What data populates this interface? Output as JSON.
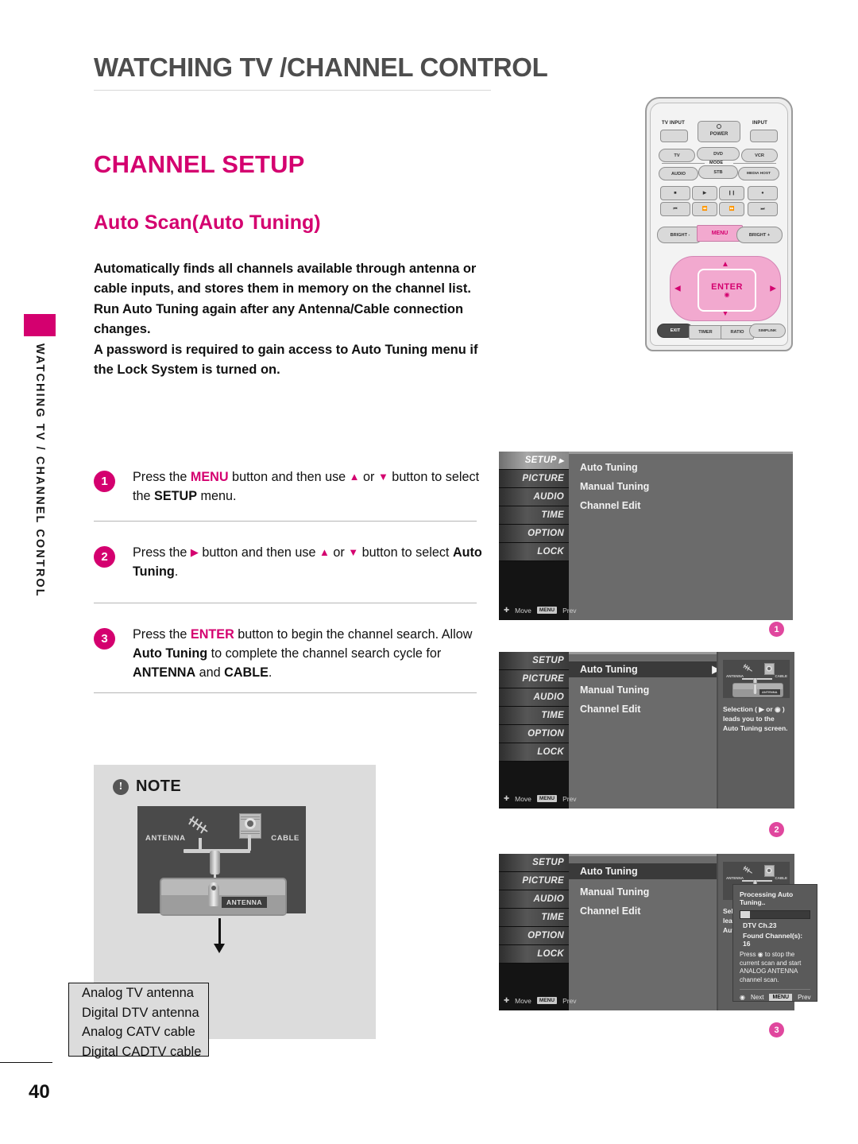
{
  "page": {
    "number": "40",
    "doc_title": "WATCHING TV /CHANNEL CONTROL",
    "side_tab_label": "WATCHING TV / CHANNEL CONTROL"
  },
  "headings": {
    "h1": "CHANNEL SETUP",
    "h2": "Auto Scan(Auto Tuning)"
  },
  "intro": {
    "p1": "Automatically finds all channels available through antenna or cable inputs, and stores them in memory on the channel list.",
    "p2": "Run Auto Tuning again after any Antenna/Cable connection changes.",
    "p3": "A password is required to gain access to Auto Tuning menu if the Lock System is turned on."
  },
  "steps": [
    {
      "num": "1",
      "parts": [
        {
          "t": "Press the ",
          "style": "normal"
        },
        {
          "t": "MENU",
          "style": "magenta"
        },
        {
          "t": " button and then use ",
          "style": "normal"
        },
        {
          "t": "▲",
          "style": "arrow"
        },
        {
          "t": " or ",
          "style": "normal"
        },
        {
          "t": "▼",
          "style": "arrow"
        },
        {
          "t": " button to select the ",
          "style": "normal"
        },
        {
          "t": "SETUP",
          "style": "bold"
        },
        {
          "t": " menu.",
          "style": "normal"
        }
      ]
    },
    {
      "num": "2",
      "parts": [
        {
          "t": "Press the ",
          "style": "normal"
        },
        {
          "t": "▶",
          "style": "arrow"
        },
        {
          "t": " button and then use ",
          "style": "normal"
        },
        {
          "t": "▲",
          "style": "arrow"
        },
        {
          "t": " or ",
          "style": "normal"
        },
        {
          "t": "▼",
          "style": "arrow"
        },
        {
          "t": " button to select ",
          "style": "normal"
        },
        {
          "t": "Auto Tuning",
          "style": "bold"
        },
        {
          "t": ".",
          "style": "normal"
        }
      ]
    },
    {
      "num": "3",
      "parts": [
        {
          "t": "Press the ",
          "style": "normal"
        },
        {
          "t": "ENTER",
          "style": "magenta"
        },
        {
          "t": " button to begin the channel search. Allow ",
          "style": "normal"
        },
        {
          "t": "Auto Tuning",
          "style": "bold"
        },
        {
          "t": " to complete the channel search cycle for ",
          "style": "normal"
        },
        {
          "t": "ANTENNA",
          "style": "bold"
        },
        {
          "t": " and ",
          "style": "normal"
        },
        {
          "t": "CABLE",
          "style": "bold"
        },
        {
          "t": ".",
          "style": "normal"
        }
      ]
    }
  ],
  "note": {
    "label": "NOTE",
    "bang": "!",
    "diagram": {
      "antenna_label": "ANTENNA",
      "cable_label": "CABLE",
      "tv_jack_label": "ANTENNA"
    },
    "list": [
      "Analog TV antenna",
      "Digital DTV antenna",
      "Analog CATV cable",
      "Digital CADTV cable"
    ]
  },
  "osd": {
    "sidebar_items": [
      "SETUP",
      "PICTURE",
      "AUDIO",
      "TIME",
      "OPTION",
      "LOCK"
    ],
    "footer_move": "Move",
    "footer_menu_key": "MENU",
    "footer_prev": "Prev",
    "menu_items": [
      "Auto Tuning",
      "Manual Tuning",
      "Channel Edit"
    ],
    "right_panel_text": "Selection ( ▶ or ◉ ) leads you to the Auto Tuning screen.",
    "mini_antenna_label": "ANTENNA",
    "mini_cable_label": "CABLE",
    "mini_jack_label": "ANTENNA",
    "caret": "▶"
  },
  "dialog": {
    "title": "Processing Auto Tuning..",
    "progress_percent": 14,
    "line1": "DTV Ch.23",
    "line2": "Found Channel(s): 16",
    "note": "Press ◉ to stop the current scan and start ANALOG ANTENNA channel  scan.",
    "next_label": "Next",
    "menu_key": "MENU",
    "prev_label": "Prev"
  },
  "badges": [
    "1",
    "2",
    "3"
  ],
  "remote": {
    "tv_input": "TV INPUT",
    "power": "POWER",
    "input": "INPUT",
    "mode_label": "MODE",
    "mode_row1": [
      "TV",
      "DVD",
      "VCR"
    ],
    "mode_row2": [
      "AUDIO",
      "STB",
      "MEDIA HOST"
    ],
    "bright_minus": "BRIGHT -",
    "menu": "MENU",
    "bright_plus": "BRIGHT +",
    "enter": "ENTER",
    "bottom_row": [
      "EXIT",
      "TIMER",
      "RATIO",
      "SIMPLINK"
    ]
  },
  "colors": {
    "magenta": "#D4006F",
    "badge_pink": "#E0479E",
    "note_bg": "#dcdcdc",
    "osd_bg": "#6b6b6b"
  }
}
